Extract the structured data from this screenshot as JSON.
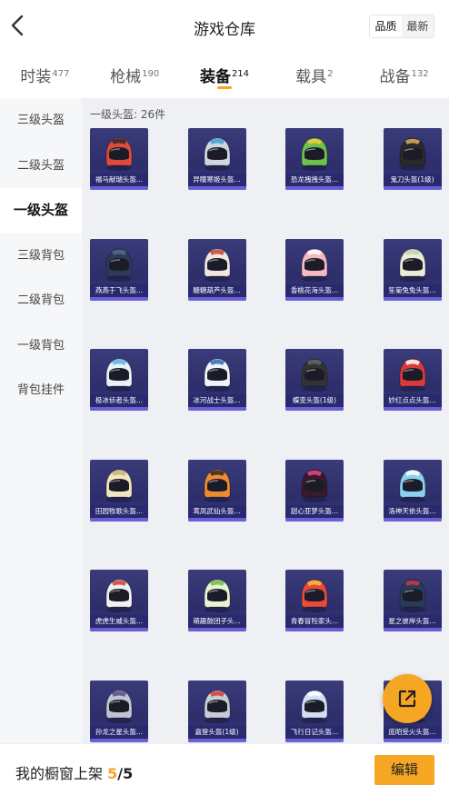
{
  "header": {
    "title": "游戏仓库",
    "sort_options": [
      "品质",
      "最新"
    ],
    "sort_selected": 0
  },
  "tabs": [
    {
      "label": "时装",
      "count": "477",
      "active": false
    },
    {
      "label": "枪械",
      "count": "190",
      "active": false
    },
    {
      "label": "装备",
      "count": "214",
      "active": true
    },
    {
      "label": "载具",
      "count": "2",
      "active": false
    },
    {
      "label": "战备",
      "count": "132",
      "active": false
    }
  ],
  "sidebar": {
    "items": [
      "三级头盔",
      "二级头盔",
      "一级头盔",
      "三级背包",
      "二级背包",
      "一级背包",
      "背包挂件"
    ],
    "active_index": 2
  },
  "main": {
    "section_title": "一级头盔: 26件",
    "items": [
      {
        "name": "福马献瑞头盔...",
        "color": "#e04a3a",
        "accent": "#2a2a2a"
      },
      {
        "name": "异瞳寒姬头盔...",
        "color": "#cfd6de",
        "accent": "#3aa0d8"
      },
      {
        "name": "恐龙拽拽头盔...",
        "color": "#6cc24a",
        "accent": "#f0d040"
      },
      {
        "name": "鬼刀头盔(1级)",
        "color": "#2a2a2a",
        "accent": "#d8b060"
      },
      {
        "name": "燕燕于飞头盔...",
        "color": "#2e3a5a",
        "accent": "#5a6a8a"
      },
      {
        "name": "糖糖葫芦头盔...",
        "color": "#f0e6e0",
        "accent": "#d0402e"
      },
      {
        "name": "香桃花海头盔...",
        "color": "#f4b8c4",
        "accent": "#ffffff"
      },
      {
        "name": "笙菊兔兔头盔...",
        "color": "#e8ecd8",
        "accent": "#c8d0b0"
      },
      {
        "name": "极冰侦者头盔...",
        "color": "#e8f0f8",
        "accent": "#5ab0e8"
      },
      {
        "name": "冰河战士头盔...",
        "color": "#f0f4f8",
        "accent": "#2e6ab8"
      },
      {
        "name": "蝶变头盔(1级)",
        "color": "#333333",
        "accent": "#666666"
      },
      {
        "name": "妙红点点头盔...",
        "color": "#d83a3a",
        "accent": "#ffffff"
      },
      {
        "name": "田园牧歌头盔...",
        "color": "#f0e6c0",
        "accent": "#c8b078"
      },
      {
        "name": "鸾凤武仙头盔...",
        "color": "#f08a30",
        "accent": "#2a2a2a"
      },
      {
        "name": "甜心亚梦头盔...",
        "color": "#3a1a2a",
        "accent": "#e84a8a"
      },
      {
        "name": "洛神天依头盔...",
        "color": "#8ad0f0",
        "accent": "#ffffff"
      },
      {
        "name": "虎虎生威头盔...",
        "color": "#f0f0f0",
        "accent": "#d83a3a"
      },
      {
        "name": "萌趣鼓团子头...",
        "color": "#e8f4d0",
        "accent": "#6ac040"
      },
      {
        "name": "青春冒险家头...",
        "color": "#e84a3a",
        "accent": "#f0c040"
      },
      {
        "name": "星之彼岸头盔...",
        "color": "#2a3a5a",
        "accent": "#c83a4a"
      },
      {
        "name": "孙龙之星头盔...",
        "color": "#c0c4d0",
        "accent": "#5a4a8a"
      },
      {
        "name": "嘉登头盔(1级)",
        "color": "#c8ccd4",
        "accent": "#d83a3a"
      },
      {
        "name": "飞行日记头盔...",
        "color": "#d0e0f4",
        "accent": "#ffffff"
      },
      {
        "name": "庞昭受火头盔...",
        "color": "#f0a040",
        "accent": "#3a3a3a"
      }
    ]
  },
  "footer": {
    "label": "我的橱窗上架",
    "current": "5",
    "separator": "/",
    "max": "5",
    "edit_label": "编辑"
  },
  "colors": {
    "accent": "#f5a623",
    "card_bg": "#3a3b7a",
    "sidebar_bg": "#f6f7f9",
    "main_bg": "#eef0f3"
  }
}
